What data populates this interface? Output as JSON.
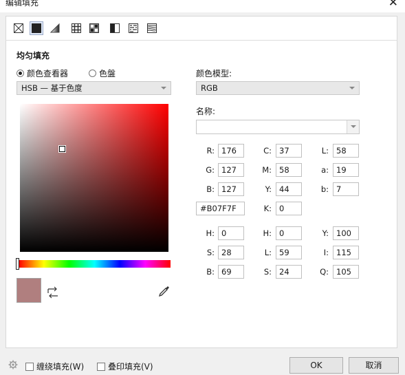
{
  "window": {
    "title": "编辑填充",
    "close_glyph": "✕"
  },
  "fill_types": [
    {
      "name": "no-fill-icon",
      "active": false
    },
    {
      "name": "uniform-fill-icon",
      "active": true
    },
    {
      "name": "fountain-fill-icon",
      "active": false
    },
    {
      "name": "vector-pattern-icon",
      "active": false
    },
    {
      "name": "bitmap-pattern-icon",
      "active": false
    },
    {
      "name": "two-color-pattern-icon",
      "active": false
    },
    {
      "name": "texture-fill-icon",
      "active": false
    },
    {
      "name": "postscript-fill-icon",
      "active": false
    }
  ],
  "section": {
    "title": "均匀填充"
  },
  "mode": {
    "viewer_label": "颜色查看器",
    "palette_label": "色盤",
    "selected": "viewer"
  },
  "viewer_select": {
    "value": "HSB — 基于色度"
  },
  "model": {
    "label": "颜色模型:",
    "value": "RGB"
  },
  "name": {
    "label": "名称:",
    "value": ""
  },
  "color": {
    "hex": "#B07F7F",
    "swatch": "#b07f7f"
  },
  "rgb": {
    "r_label": "R:",
    "r": "176",
    "g_label": "G:",
    "g": "127",
    "b_label": "B:",
    "b": "127"
  },
  "cmyk": {
    "c_label": "C:",
    "c": "37",
    "m_label": "M:",
    "m": "58",
    "y_label": "Y:",
    "y": "44",
    "k_label": "K:",
    "k": "0"
  },
  "lab": {
    "l_label": "L:",
    "l": "58",
    "a_label": "a:",
    "a": "19",
    "b_label": "b:",
    "b": "7"
  },
  "hsb": {
    "h_label": "H:",
    "h": "0",
    "s_label": "S:",
    "s": "28",
    "b_label": "B:",
    "b": "69"
  },
  "hls": {
    "h_label": "H:",
    "h": "0",
    "l_label": "L:",
    "l": "59",
    "s_label": "S:",
    "s": "24"
  },
  "yiq": {
    "y_label": "Y:",
    "y": "100",
    "i_label": "I:",
    "i": "115",
    "q_label": "Q:",
    "q": "105"
  },
  "footer": {
    "wrap_label": "缠绕填充(W)",
    "overprint_label": "叠印填充(V)",
    "ok_label": "OK",
    "cancel_label": "取消"
  }
}
